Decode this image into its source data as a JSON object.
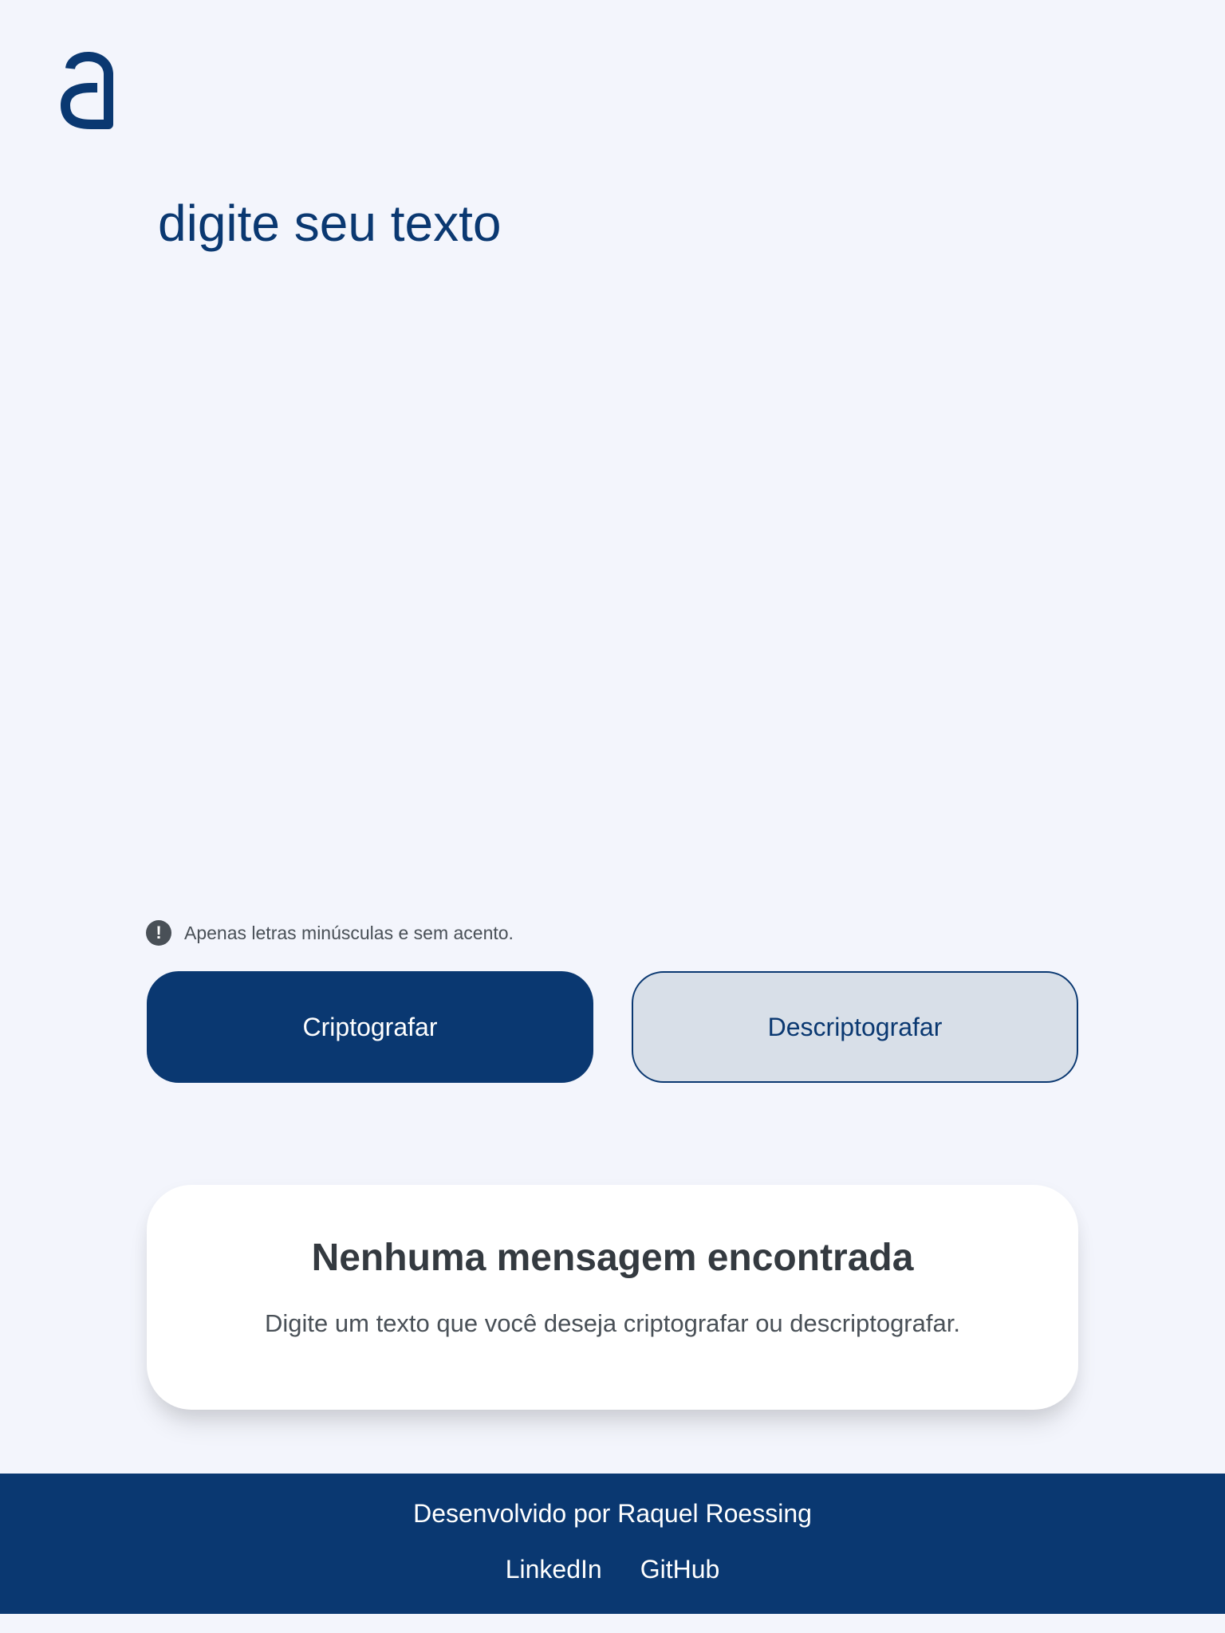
{
  "brand": {
    "logo_text": "a",
    "primary_color": "#0A3871",
    "background_color": "#F3F5FC"
  },
  "input": {
    "placeholder": "digite seu texto",
    "value": ""
  },
  "hint": {
    "icon": "exclamation-circle-icon",
    "text": "Apenas letras minúsculas e sem acento."
  },
  "actions": {
    "encrypt_label": "Criptografar",
    "decrypt_label": "Descriptografar"
  },
  "result": {
    "title": "Nenhuma mensagem encontrada",
    "description": "Digite um texto que você deseja criptografar ou descriptografar."
  },
  "footer": {
    "credit": "Desenvolvido por Raquel Roessing",
    "links": [
      {
        "label": "LinkedIn"
      },
      {
        "label": "GitHub"
      }
    ]
  }
}
